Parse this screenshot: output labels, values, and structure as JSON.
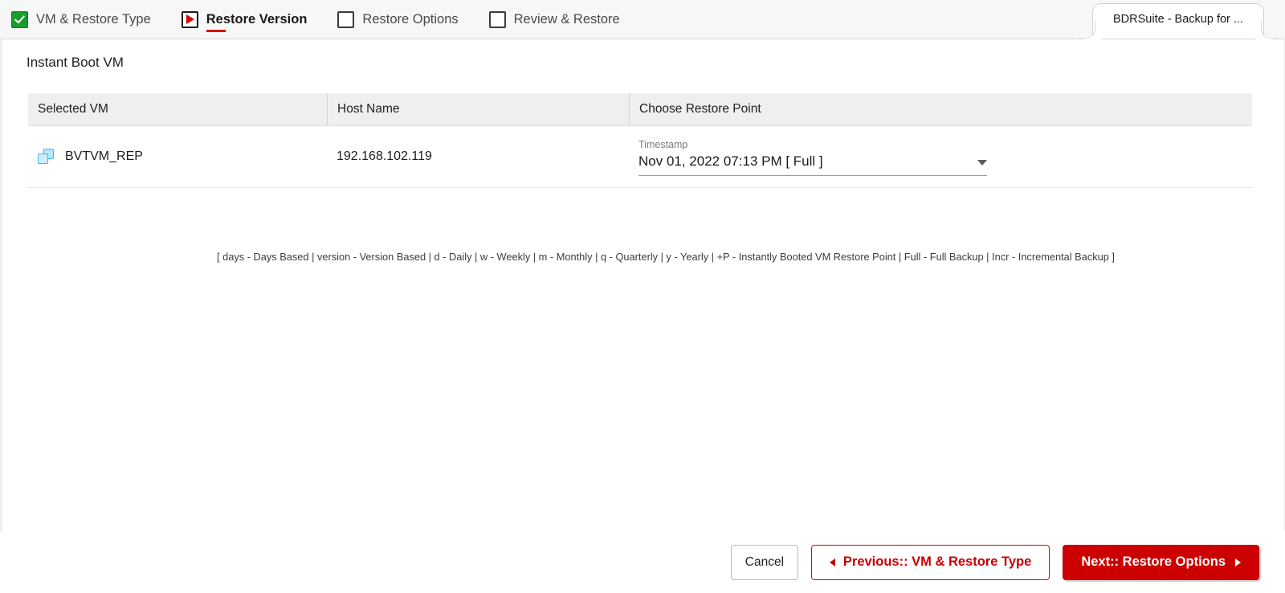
{
  "wizard": {
    "steps": [
      {
        "label": "VM & Restore Type",
        "state": "done",
        "icon": "checked-checkbox-icon"
      },
      {
        "label": "Restore Version",
        "state": "current",
        "icon": "play-triangle-icon"
      },
      {
        "label": "Restore Options",
        "state": "todo",
        "icon": "empty-checkbox-icon"
      },
      {
        "label": "Review & Restore",
        "state": "todo",
        "icon": "empty-checkbox-icon"
      }
    ]
  },
  "browser_tab": {
    "title": "BDRSuite - Backup for ..."
  },
  "page": {
    "title": "Instant Boot VM"
  },
  "table": {
    "columns": [
      "Selected VM",
      "Host Name",
      "Choose Restore Point"
    ],
    "rows": [
      {
        "vm_icon": "vm-stack-icon",
        "vm_name": "BVTVM_REP",
        "host_name": "192.168.102.119",
        "restore_point": {
          "field_label": "Timestamp",
          "value": "Nov 01, 2022 07:13 PM [ Full ]",
          "caret_icon": "chevron-down-icon"
        }
      }
    ]
  },
  "legend": {
    "text": "[ days - Days Based | version - Version Based | d - Daily | w - Weekly | m - Monthly | q - Quarterly | y - Yearly | +P - Instantly Booted VM Restore Point | Full - Full Backup | Incr - Incremental Backup ]"
  },
  "footer": {
    "cancel_label": "Cancel",
    "previous_label": "Previous:: VM & Restore Type",
    "next_label": "Next:: Restore Options"
  },
  "colors": {
    "brand_red": "#cc0000",
    "step_done_green": "#1a9b2e",
    "header_gray": "#efefef",
    "vm_icon_blue": "#3fb7e8"
  }
}
